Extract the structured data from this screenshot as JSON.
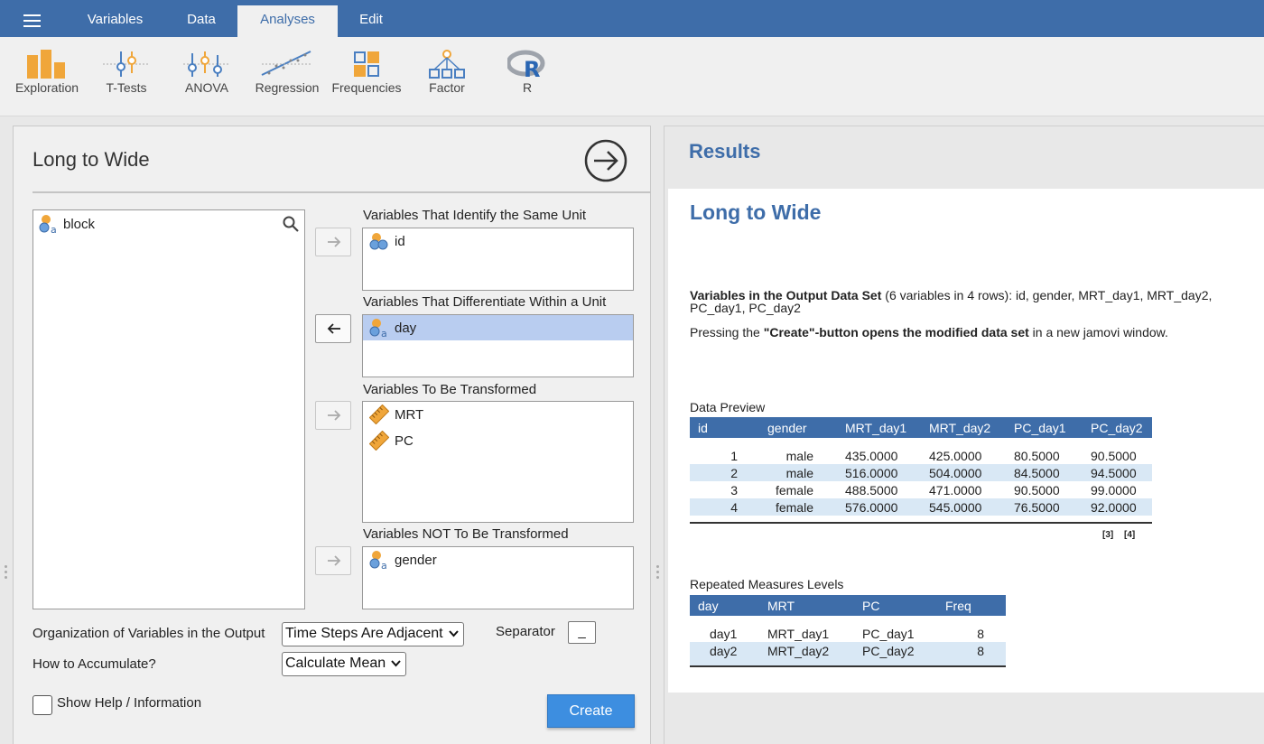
{
  "menu": {
    "tabs": [
      {
        "label": "Variables"
      },
      {
        "label": "Data"
      },
      {
        "label": "Analyses",
        "active": true
      },
      {
        "label": "Edit"
      }
    ]
  },
  "ribbon": {
    "items": [
      {
        "label": "Exploration",
        "icon": "exploration-icon"
      },
      {
        "label": "T-Tests",
        "icon": "t-tests-icon"
      },
      {
        "label": "ANOVA",
        "icon": "anova-icon"
      },
      {
        "label": "Regression",
        "icon": "regression-icon"
      },
      {
        "label": "Frequencies",
        "icon": "frequencies-icon"
      },
      {
        "label": "Factor",
        "icon": "factor-icon"
      },
      {
        "label": "R",
        "icon": "r-icon"
      }
    ]
  },
  "options_panel": {
    "title": "Long to Wide",
    "available_variables": [
      {
        "name": "block",
        "icon": "nominal-text-icon"
      }
    ],
    "targets": [
      {
        "label": "Variables That Identify the Same Unit",
        "items": [
          {
            "name": "id",
            "icon": "id-icon"
          }
        ]
      },
      {
        "label": "Variables That Differentiate Within a Unit",
        "items": [
          {
            "name": "day",
            "icon": "nominal-text-icon",
            "selected": true
          }
        ]
      },
      {
        "label": "Variables To Be Transformed",
        "items": [
          {
            "name": "MRT",
            "icon": "continuous-icon"
          },
          {
            "name": "PC",
            "icon": "continuous-icon"
          }
        ]
      },
      {
        "label": "Variables NOT To Be Transformed",
        "items": [
          {
            "name": "gender",
            "icon": "nominal-text-icon"
          }
        ]
      }
    ],
    "organization_label": "Organization of Variables in the Output",
    "organization_value": "Time Steps Are Adjacent",
    "separator_label": "Separator",
    "separator_value": "_",
    "accumulate_label": "How to Accumulate?",
    "accumulate_value": "Calculate Mean",
    "show_help_label": "Show Help / Information",
    "show_help_checked": false,
    "create_label": "Create"
  },
  "results": {
    "header": "Results",
    "title": "Long to Wide",
    "output_vars_bold": "Variables in the Output Data Set",
    "output_vars_text": " (6 variables in 4 rows): id, gender, MRT_day1, MRT_day2,",
    "output_vars_text2": "PC_day1, PC_day2",
    "pressing_pre": "Pressing the ",
    "pressing_bold": "\"Create\"-button opens the modified data set",
    "pressing_post": " in a new jamovi window.",
    "preview": {
      "caption": "Data Preview",
      "columns": [
        "id",
        "gender",
        "MRT_day1",
        "MRT_day2",
        "PC_day1",
        "PC_day2"
      ],
      "rows": [
        [
          "1",
          "male",
          "435.0000",
          "425.0000",
          "80.5000",
          "90.5000"
        ],
        [
          "2",
          "male",
          "516.0000",
          "504.0000",
          "84.5000",
          "94.5000"
        ],
        [
          "3",
          "female",
          "488.5000",
          "471.0000",
          "90.5000",
          "99.0000"
        ],
        [
          "4",
          "female",
          "576.0000",
          "545.0000",
          "76.5000",
          "92.0000"
        ]
      ],
      "footnotes": [
        "[3]",
        "[4]"
      ]
    },
    "levels": {
      "caption": "Repeated Measures Levels",
      "columns": [
        "day",
        "MRT",
        "PC",
        "Freq"
      ],
      "rows": [
        [
          "day1",
          "MRT_day1",
          "PC_day1",
          "8"
        ],
        [
          "day2",
          "MRT_day2",
          "PC_day2",
          "8"
        ]
      ]
    }
  },
  "colors": {
    "brand": "#3e6da9",
    "selection": "#b9cdf0",
    "create_button": "#3d8ee0",
    "row_alt": "#d9e8f5"
  }
}
